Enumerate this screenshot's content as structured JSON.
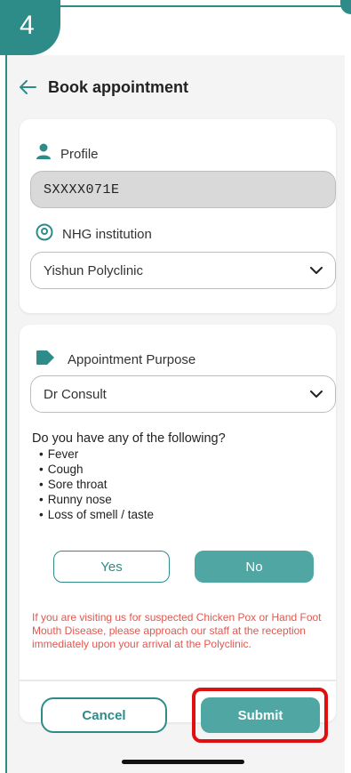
{
  "step_badge": "4",
  "header": {
    "title": "Book appointment"
  },
  "profile": {
    "label": "Profile",
    "value": "SXXXX071E"
  },
  "institution": {
    "label": "NHG institution",
    "selected": "Yishun Polyclinic"
  },
  "purpose": {
    "label": "Appointment Purpose",
    "selected": "Dr Consult"
  },
  "screening": {
    "question": "Do you have any of the following?",
    "symptoms": [
      "Fever",
      "Cough",
      "Sore throat",
      "Runny nose",
      "Loss of smell / taste"
    ],
    "yes_label": "Yes",
    "no_label": "No"
  },
  "warning": "If you are visiting us for suspected Chicken Pox or Hand Foot Mouth Disease, please approach our staff at the reception immediately upon your arrival at the Polyclinic.",
  "actions": {
    "cancel_label": "Cancel",
    "submit_label": "Submit"
  },
  "colors": {
    "primary": "#2e8c88",
    "button_fill": "#4fa6a2",
    "warning": "#e0584f",
    "highlight": "#e01010"
  }
}
